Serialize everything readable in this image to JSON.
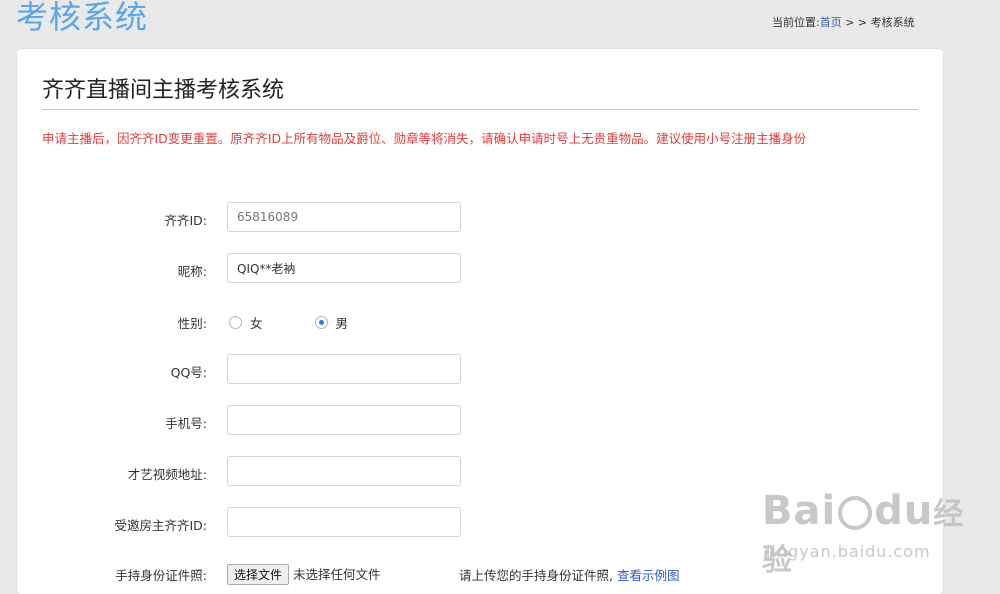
{
  "header": {
    "title": "考核系统",
    "breadcrumb_prefix": "当前位置:",
    "breadcrumb_home": "首页",
    "breadcrumb_sep": " > > ",
    "breadcrumb_current": "考核系统"
  },
  "card": {
    "title": "齐齐直播间主播考核系统",
    "notice": "申请主播后，因齐齐ID变更重置。原齐齐ID上所有物品及爵位、勋章等将消失，请确认申请时号上无贵重物品。建议使用小号注册主播身份"
  },
  "form": {
    "qiqi_id": {
      "label": "齐齐ID:",
      "value": "65816089"
    },
    "nickname": {
      "label": "昵称:",
      "value": "QIQ**老衲"
    },
    "gender": {
      "label": "性别:",
      "options": [
        {
          "label": "女",
          "checked": false
        },
        {
          "label": "男",
          "checked": true
        }
      ]
    },
    "qq": {
      "label": "QQ号:",
      "value": ""
    },
    "phone": {
      "label": "手机号:",
      "value": ""
    },
    "talent_video": {
      "label": "才艺视频地址:",
      "value": ""
    },
    "inviter_id": {
      "label": "受邀房主齐齐ID:",
      "value": ""
    },
    "id_photo": {
      "label": "手持身份证件照:",
      "button": "选择文件",
      "status": "未选择任何文件",
      "hint": "请上传您的手持身份证件照,",
      "link": "查看示例图"
    }
  },
  "watermark": {
    "logo_left": "Bai",
    "logo_right": "du",
    "logo_cn": "经验",
    "url": "jingyan.baidu.com"
  }
}
